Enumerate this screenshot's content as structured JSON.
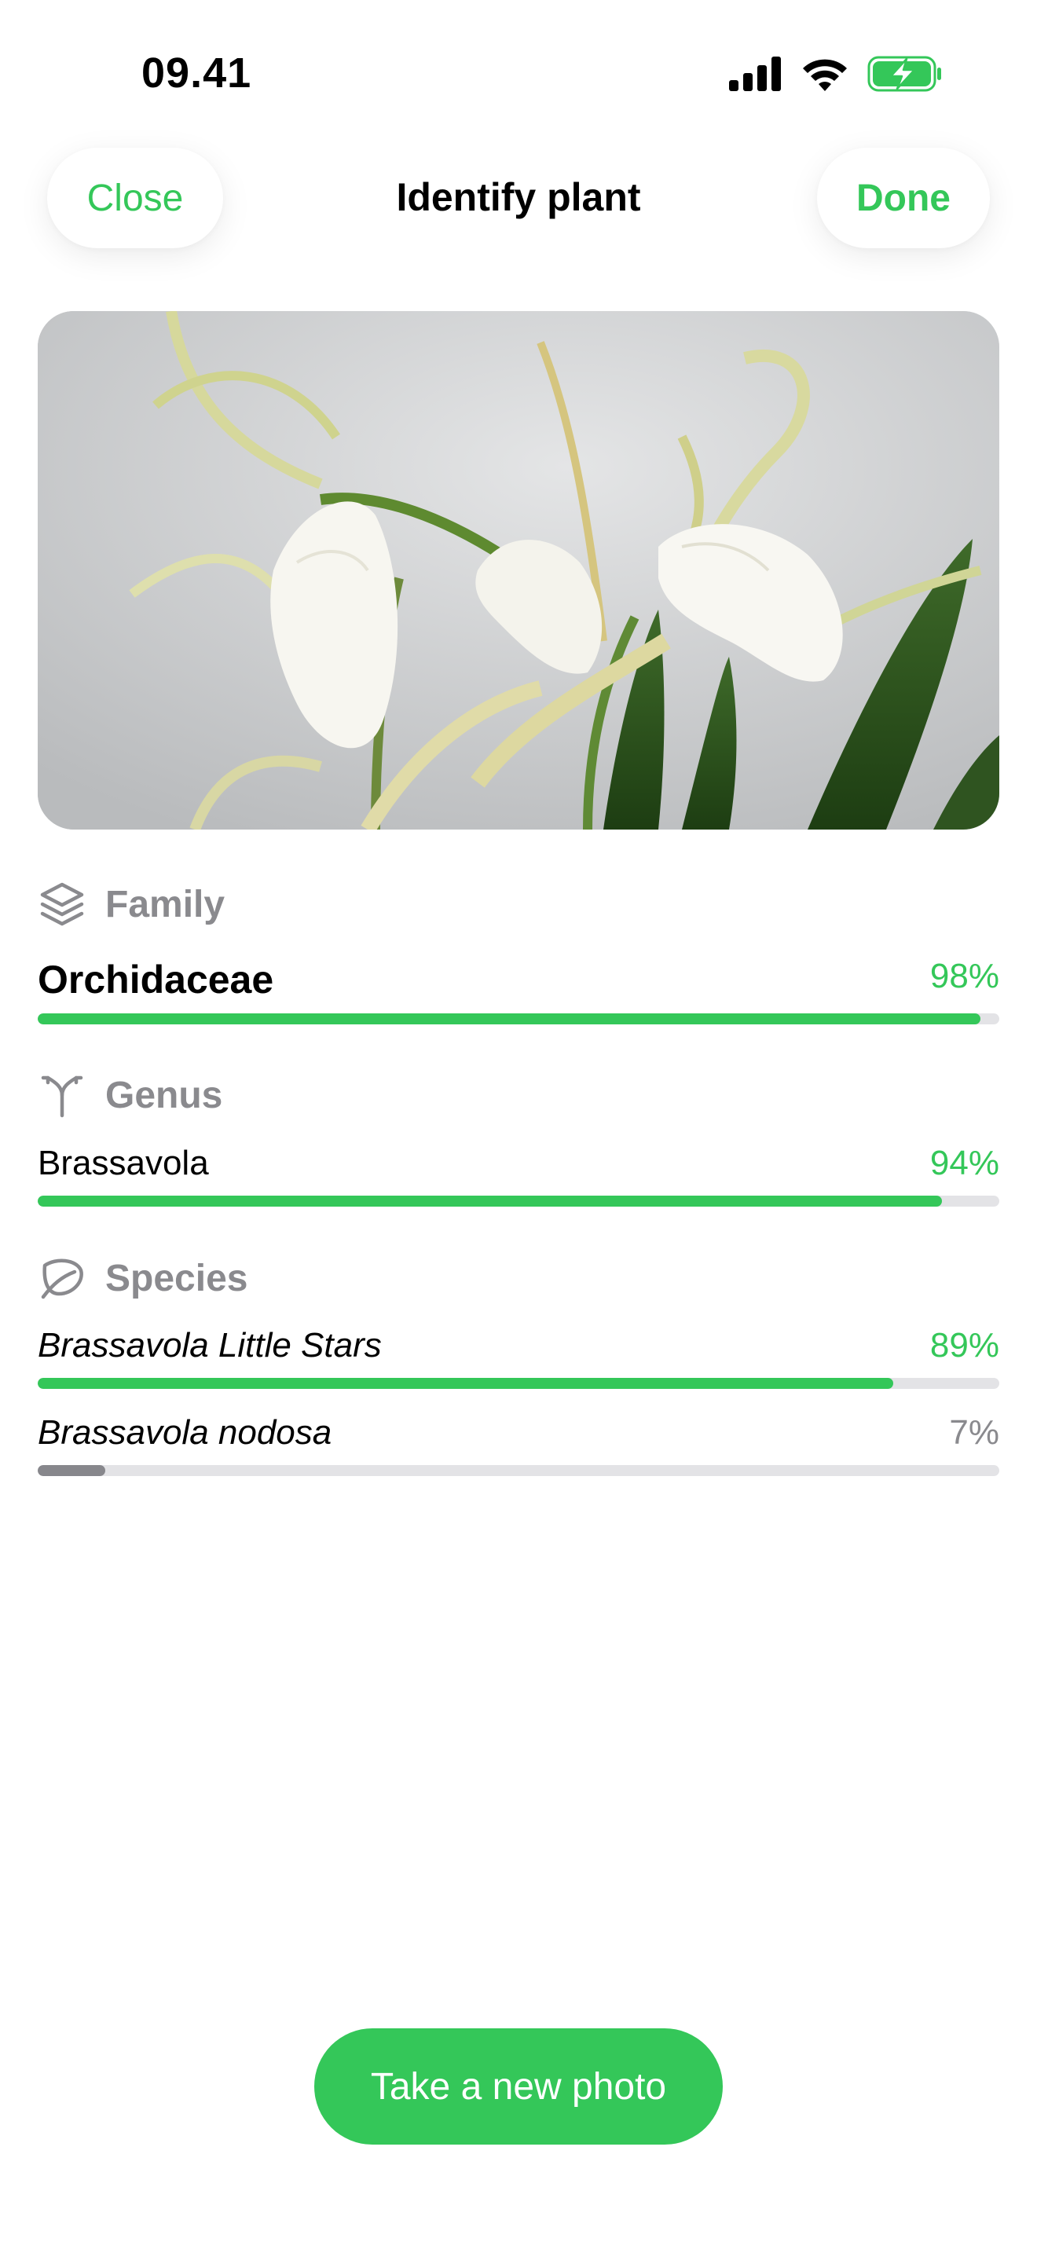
{
  "status": {
    "time": "09.41"
  },
  "header": {
    "close_label": "Close",
    "title": "Identify plant",
    "done_label": "Done"
  },
  "sections": {
    "family": {
      "label": "Family",
      "icon": "layers-icon",
      "results": [
        {
          "name": "Orchidaceae",
          "percent_label": "98%",
          "fraction": 0.98
        }
      ]
    },
    "genus": {
      "label": "Genus",
      "icon": "branch-icon",
      "results": [
        {
          "name": "Brassavola",
          "percent_label": "94%",
          "fraction": 0.94
        }
      ]
    },
    "species": {
      "label": "Species",
      "icon": "leaf-icon",
      "results": [
        {
          "name": "Brassavola Little Stars",
          "percent_label": "89%",
          "fraction": 0.89
        },
        {
          "name": "Brassavola nodosa",
          "percent_label": "7%",
          "fraction": 0.07
        }
      ]
    }
  },
  "action": {
    "new_photo_label": "Take a new photo"
  },
  "colors": {
    "accent": "#34c759",
    "secondary": "#8a8a8e",
    "track": "#e3e3e6"
  }
}
